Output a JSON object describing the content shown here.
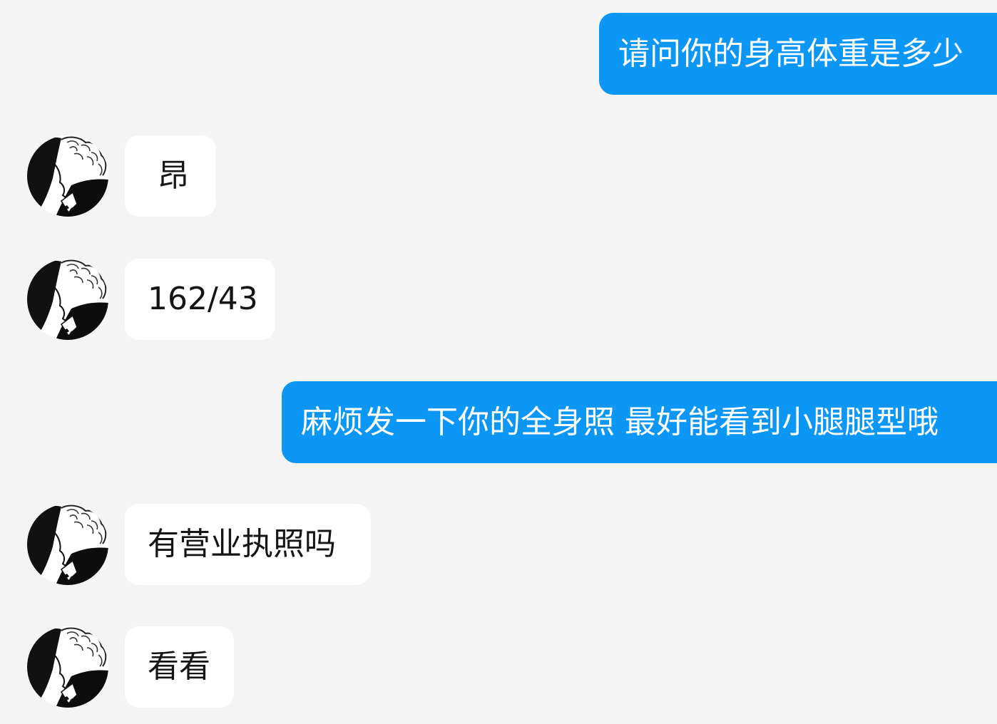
{
  "messages": [
    {
      "direction": "outgoing",
      "text": "请问你的身高体重是多少"
    },
    {
      "direction": "incoming",
      "text": "昂",
      "avatar_icon": "avatar-icon"
    },
    {
      "direction": "incoming",
      "text": "162/43",
      "avatar_icon": "avatar-icon"
    },
    {
      "direction": "outgoing",
      "text": "麻烦发一下你的全身照 最好能看到小腿腿型哦"
    },
    {
      "direction": "incoming",
      "text": "有营业执照吗",
      "avatar_icon": "avatar-icon"
    },
    {
      "direction": "incoming",
      "text": "看看",
      "avatar_icon": "avatar-icon"
    }
  ],
  "colors": {
    "background": "#f4f4f4",
    "outgoing_bubble": "#0c97f7",
    "incoming_bubble": "#ffffff",
    "incoming_text": "#151515",
    "outgoing_text": "#ffffff"
  }
}
